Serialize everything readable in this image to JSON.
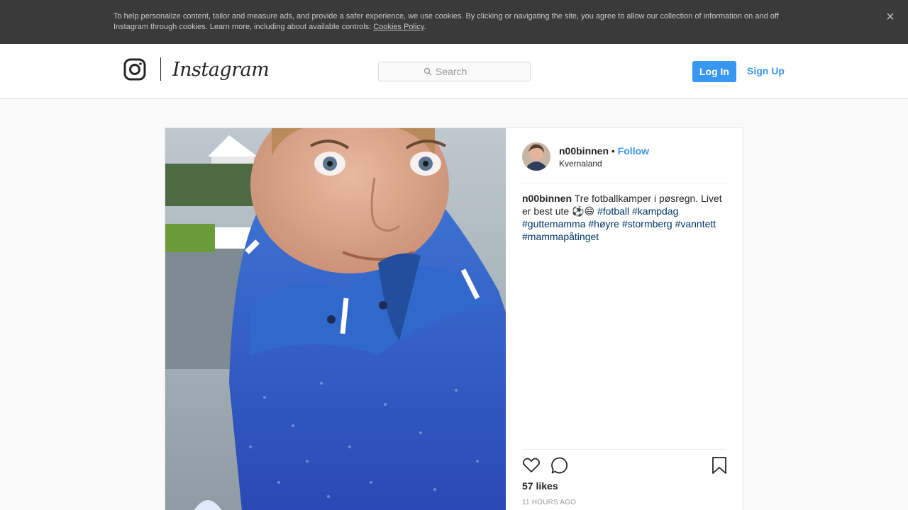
{
  "cookie_banner": {
    "text": "To help personalize content, tailor and measure ads, and provide a safer experience, we use cookies. By clicking or navigating the site, you agree to allow our collection of information on and off Instagram through cookies. Learn more, including about available controls: ",
    "policy_link": "Cookies Policy",
    "period": ".",
    "close_label": "×"
  },
  "header": {
    "logo_text": "Instagram",
    "search_placeholder": "Search",
    "login_label": "Log In",
    "signup_label": "Sign Up",
    "accent_color": "#3897f0"
  },
  "post": {
    "username": "n00binnen",
    "separator": " • ",
    "follow_label": "Follow",
    "location": "Kvernaland",
    "caption_user": "n00binnen",
    "caption_text": " Tre fotballkamper i pøsregn. Livet er best ute ⚽😄 ",
    "hashtags": [
      "#fotball",
      "#kampdag",
      "#guttemamma",
      "#høyre",
      "#stormberg",
      "#vanntett",
      "#mammapåtinget"
    ],
    "likes": "57 likes",
    "timestamp": "11 HOURS AGO",
    "icons": [
      "heart-icon",
      "comment-icon",
      "bookmark-icon"
    ]
  }
}
